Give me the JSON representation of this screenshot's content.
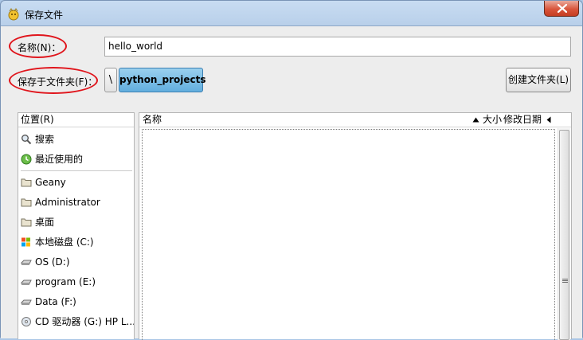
{
  "window": {
    "title": "保存文件"
  },
  "form": {
    "name_label": "名称(N)：",
    "name_value": "hello_world",
    "save_in_label": "保存于文件夹(F)：",
    "path_toggle": "\\",
    "path_segment": "python_projects",
    "create_folder": "创建文件夹(L)"
  },
  "places": {
    "header": "位置(R)",
    "items": [
      {
        "label": "搜索",
        "icon": "search-icon"
      },
      {
        "label": "最近使用的",
        "icon": "recent-icon"
      },
      {
        "label": "Geany",
        "icon": "folder-icon"
      },
      {
        "label": "Administrator",
        "icon": "folder-icon"
      },
      {
        "label": "桌面",
        "icon": "folder-icon"
      },
      {
        "label": "本地磁盘 (C:)",
        "icon": "drive-icon"
      },
      {
        "label": "OS (D:)",
        "icon": "drive-icon"
      },
      {
        "label": "program (E:)",
        "icon": "drive-icon"
      },
      {
        "label": "Data (F:)",
        "icon": "drive-icon"
      },
      {
        "label": "CD 驱动器 (G:) HP L...",
        "icon": "cd-drive-icon"
      }
    ]
  },
  "files": {
    "col_name": "名称",
    "col_size": "大小",
    "col_modified": "修改日期"
  },
  "colors": {
    "highlight": "#e0151c",
    "path_button": "#62aede"
  }
}
